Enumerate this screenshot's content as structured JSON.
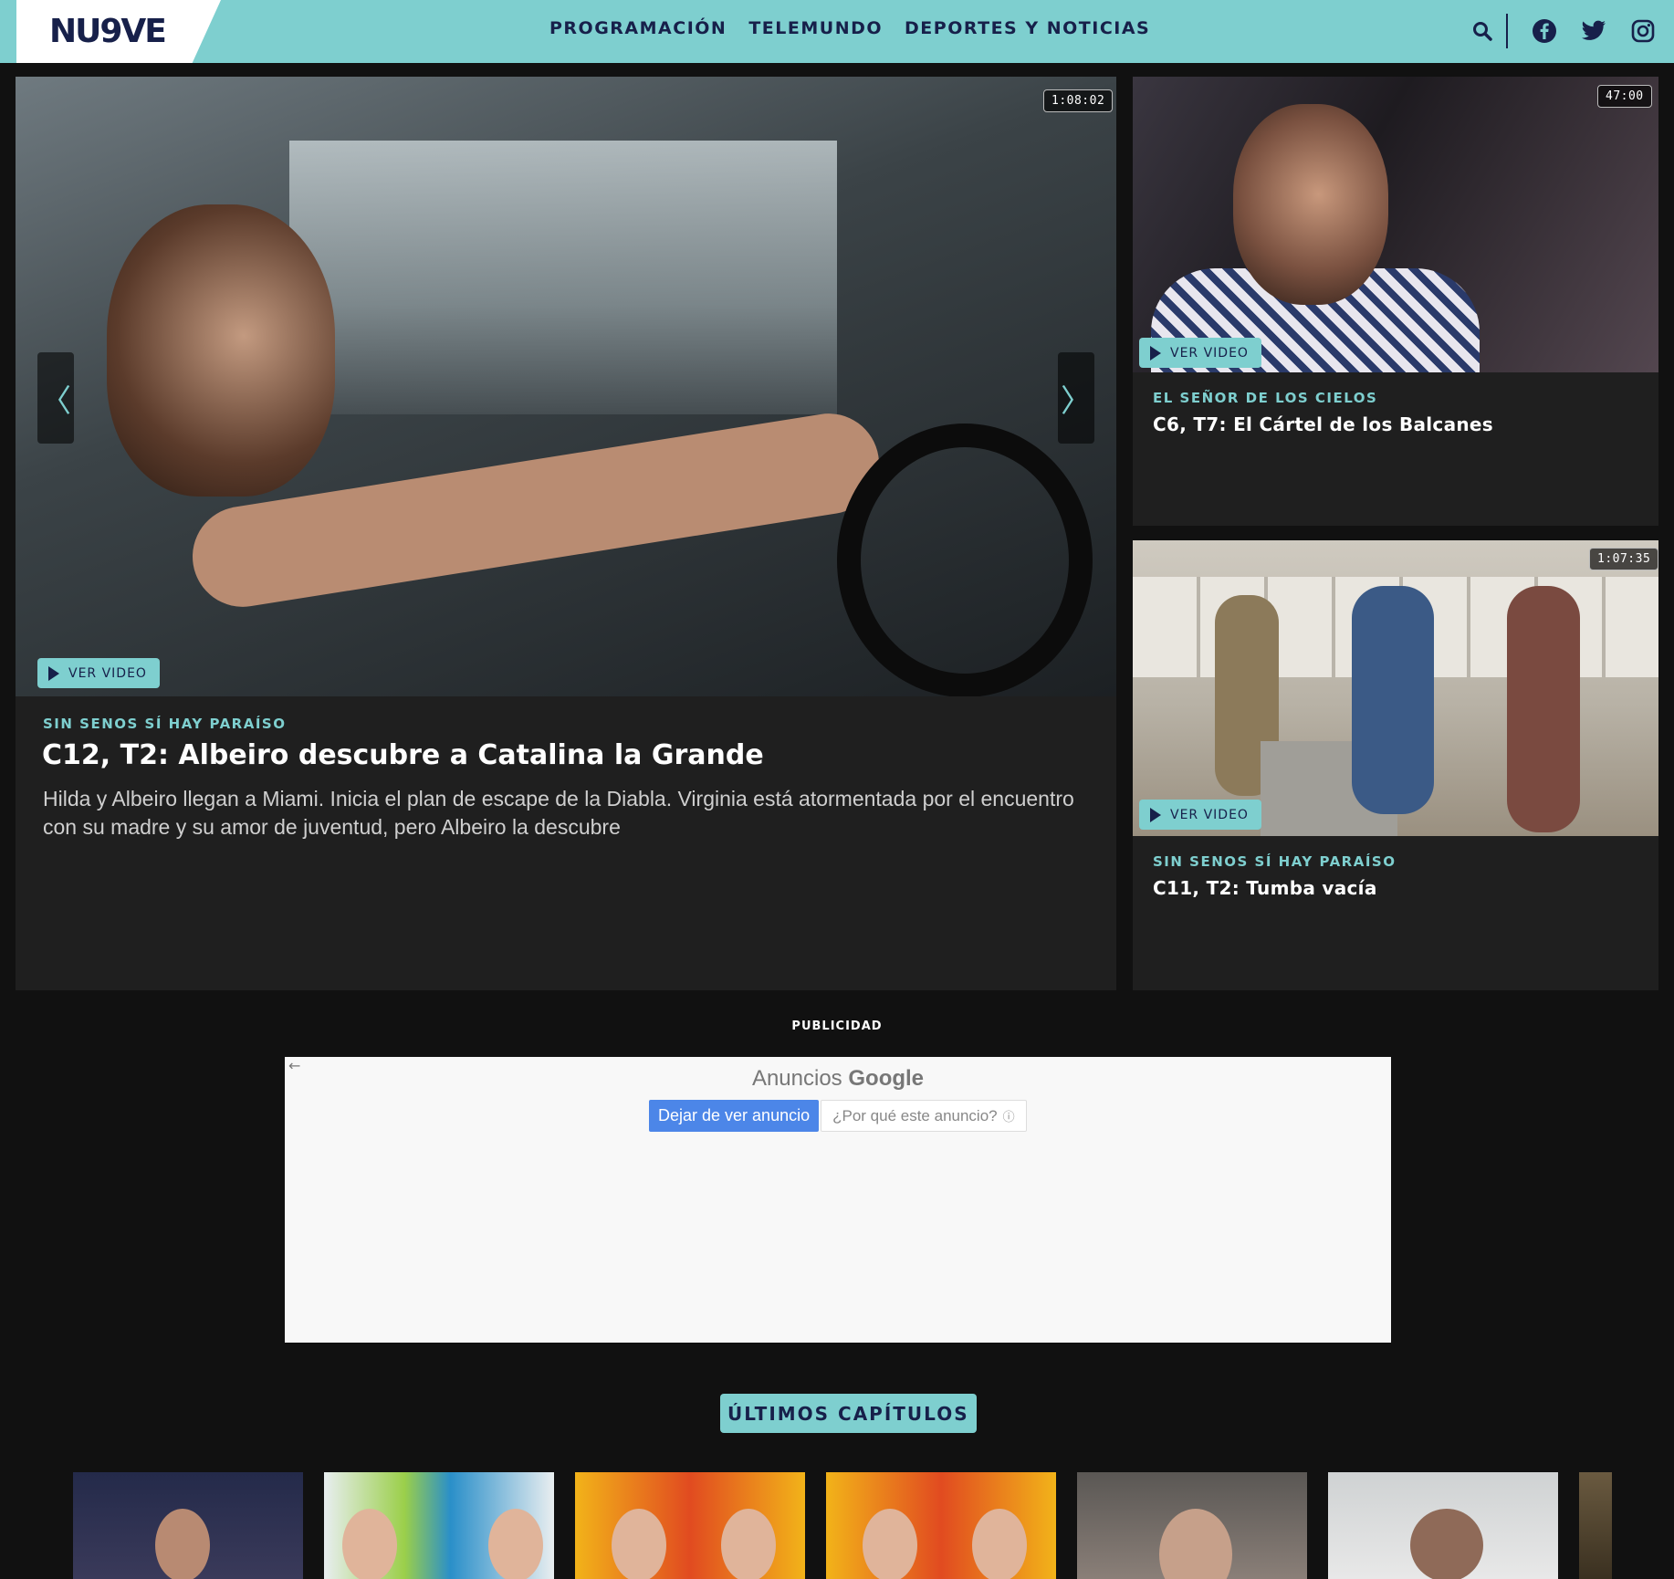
{
  "header": {
    "logo_text": "NU9VE",
    "nav": [
      "PROGRAMACIÓN",
      "TELEMUNDO",
      "DEPORTES Y NOTICIAS"
    ],
    "icons": [
      "search-icon",
      "facebook-icon",
      "twitter-icon",
      "instagram-icon"
    ]
  },
  "hero": {
    "duration": "1:08:02",
    "watch_label": "VER VIDEO",
    "category": "SIN SENOS SÍ HAY PARAÍSO",
    "title": "C12, T2: Albeiro descubre a Catalina la Grande",
    "description": "Hilda y Albeiro llegan a Miami. Inicia el plan de escape de la Diabla. Virginia está atormentada por el encuentro con su madre y su amor de juventud, pero Albeiro la descubre",
    "prev_icon": "〈",
    "next_icon": "〉"
  },
  "side_cards": [
    {
      "duration": "47:00",
      "watch_label": "VER VIDEO",
      "category": "EL SEÑOR DE LOS CIELOS",
      "title": "C6, T7: El Cártel de los Balcanes"
    },
    {
      "duration": "1:07:35",
      "watch_label": "VER VIDEO",
      "category": "SIN SENOS SÍ HAY PARAÍSO",
      "title": "C11, T2: Tumba vacía"
    }
  ],
  "ads": {
    "label": "PUBLICIDAD",
    "back_icon": "←",
    "heading_prefix": "Anuncios",
    "heading_brand": "Google",
    "stop_button": "Dejar de ver anuncio",
    "why_button": "¿Por qué este anuncio?",
    "info_icon": "ⓘ"
  },
  "latest": {
    "heading": "ÚLTIMOS CAPÍTULOS"
  },
  "colors": {
    "accent": "#7ecfcf",
    "navy": "#17204a",
    "background": "#111111",
    "card": "#1f1f1f",
    "ad_button": "#4c86e8"
  }
}
